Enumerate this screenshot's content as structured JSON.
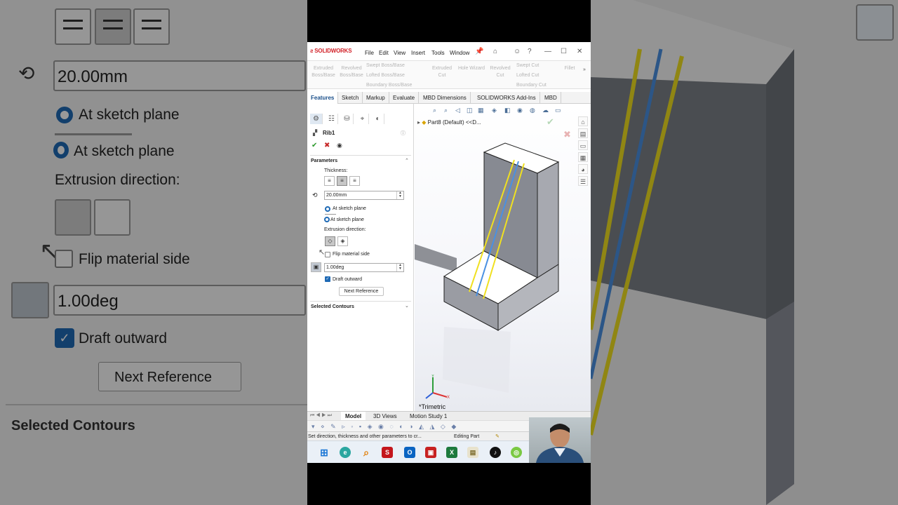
{
  "zoom_left": {
    "thickness_value": "20.00mm",
    "radio_1": "At sketch plane",
    "radio_2": "At sketch plane",
    "extrusion_direction": "Extrusion direction:",
    "flip_material": "Flip material side",
    "draft_value": "1.00deg",
    "draft_outward": "Draft outward",
    "next_reference": "Next Reference",
    "selected_contours": "Selected Contours"
  },
  "app": {
    "logo": "SOLIDWORKS",
    "menu": [
      "File",
      "Edit",
      "View",
      "Insert",
      "Tools",
      "Window"
    ]
  },
  "commands": {
    "extruded_boss": "Extruded Boss/Base",
    "revolved_boss": "Revolved Boss/Base",
    "swept_boss": "Swept Boss/Base",
    "lofted_boss": "Lofted Boss/Base",
    "boundary_boss": "Boundary Boss/Base",
    "extruded_cut": "Extruded Cut",
    "hole_wizard": "Hole Wizard",
    "revolved_cut": "Revolved Cut",
    "swept_cut": "Swept Cut",
    "lofted_cut": "Lofted Cut",
    "boundary_cut": "Boundary Cut",
    "fillet": "Fillet"
  },
  "tabs": [
    "Features",
    "Sketch",
    "Markup",
    "Evaluate",
    "MBD Dimensions",
    "SOLIDWORKS Add-Ins",
    "MBD"
  ],
  "property_manager": {
    "title": "Rib1",
    "parameters": "Parameters",
    "thickness_label": "Thickness:",
    "thickness_value": "20.00mm",
    "radio_1": "At sketch plane",
    "radio_2": "At sketch plane",
    "extrusion_direction": "Extrusion direction:",
    "flip_material": "Flip material side",
    "draft_value": "1.00deg",
    "draft_outward": "Draft outward",
    "next_reference": "Next Reference",
    "selected_contours": "Selected Contours"
  },
  "viewport": {
    "tree_item": "Part8 (Default) <<D...",
    "view_name": "*Trimetric"
  },
  "model_tabs": [
    "Model",
    "3D Views",
    "Motion Study 1"
  ],
  "status": {
    "message": "Set direction, thickness and other parameters to cr...",
    "mode": "Editing Part"
  },
  "colors": {
    "accent": "#1f6ab5",
    "rib_line_yellow": "#f0e020",
    "rib_line_blue": "#4a90e2",
    "part_side": "#8c8f96"
  }
}
